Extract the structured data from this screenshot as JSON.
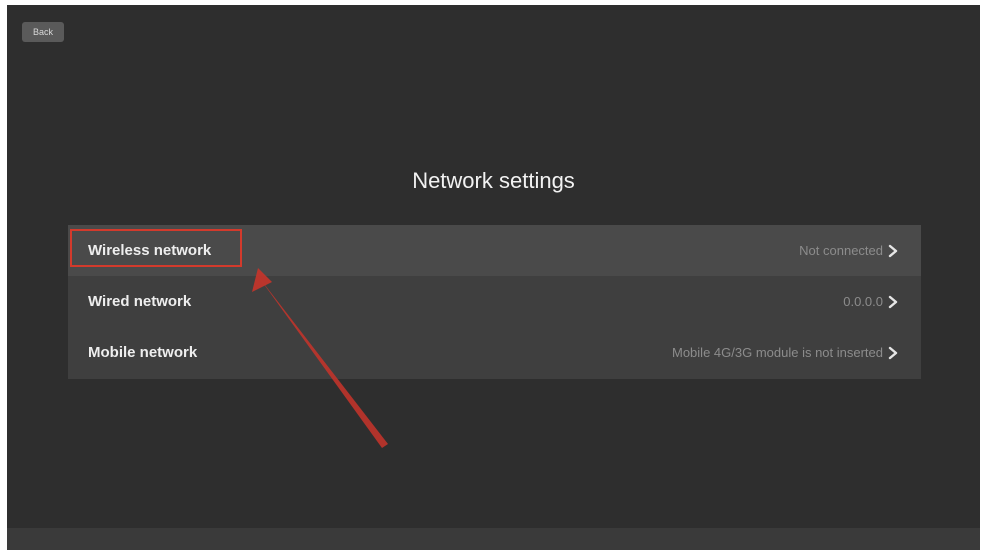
{
  "header": {
    "back_label": "Back"
  },
  "page": {
    "title": "Network settings"
  },
  "network_items": [
    {
      "label": "Wireless network",
      "value": "Not connected",
      "icon": "chevron-right-icon"
    },
    {
      "label": "Wired network",
      "value": "0.0.0.0",
      "icon": "chevron-right-icon"
    },
    {
      "label": "Mobile network",
      "value": "Mobile 4G/3G module is not inserted",
      "icon": "chevron-right-icon"
    }
  ],
  "colors": {
    "background": "#2e2e2e",
    "list_background": "#3f3f3f",
    "selected_row": "#4a4a4a",
    "annotation": "#d33a2c"
  }
}
